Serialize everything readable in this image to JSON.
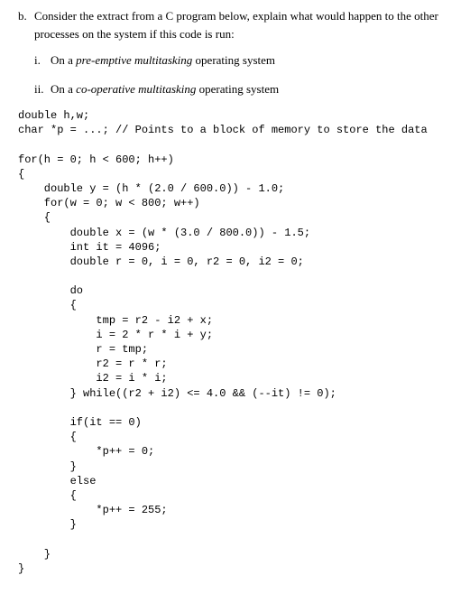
{
  "question": {
    "label": "b.",
    "text": "Consider the extract from a C program below, explain what would happen to the other processes on the system if this code is run:",
    "subs": [
      {
        "label": "i.",
        "pre": "On a ",
        "em": "pre-emptive multitasking",
        "post": " operating system"
      },
      {
        "label": "ii.",
        "pre": "On a ",
        "em": "co-operative multitasking",
        "post": " operating system"
      }
    ]
  },
  "code": "double h,w;\nchar *p = ...; // Points to a block of memory to store the data\n\nfor(h = 0; h < 600; h++)\n{\n    double y = (h * (2.0 / 600.0)) - 1.0;\n    for(w = 0; w < 800; w++)\n    {\n        double x = (w * (3.0 / 800.0)) - 1.5;\n        int it = 4096;\n        double r = 0, i = 0, r2 = 0, i2 = 0;\n\n        do\n        {\n            tmp = r2 - i2 + x;\n            i = 2 * r * i + y;\n            r = tmp;\n            r2 = r * r;\n            i2 = i * i;\n        } while((r2 + i2) <= 4.0 && (--it) != 0);\n\n        if(it == 0)\n        {\n            *p++ = 0;\n        }\n        else\n        {\n            *p++ = 255;\n        }\n\n    }\n}"
}
